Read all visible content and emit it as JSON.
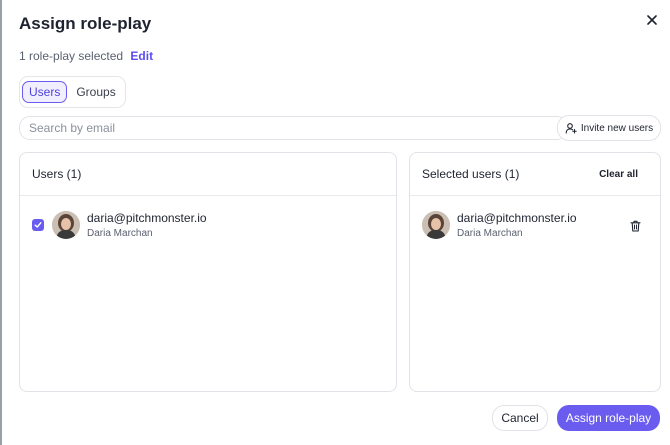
{
  "dialog": {
    "title": "Assign role-play",
    "selected_count_text": "1 role-play selected",
    "edit_label": "Edit"
  },
  "tabs": [
    {
      "label": "Users",
      "active": true
    },
    {
      "label": "Groups",
      "active": false
    }
  ],
  "search": {
    "placeholder": "Search by email",
    "value": ""
  },
  "invite_button": {
    "label": "Invite new users",
    "icon": "user-plus-icon"
  },
  "users_panel": {
    "header": "Users (1)",
    "users": [
      {
        "email": "daria@pitchmonster.io",
        "name": "Daria Marchan",
        "checked": true
      }
    ]
  },
  "selected_panel": {
    "header": "Selected users (1)",
    "clear_all_label": "Clear all",
    "users": [
      {
        "email": "daria@pitchmonster.io",
        "name": "Daria Marchan"
      }
    ]
  },
  "footer": {
    "cancel_label": "Cancel",
    "assign_label": "Assign role-play"
  },
  "colors": {
    "accent": "#6b5cf0",
    "text": "#1f2330",
    "muted": "#5b6170",
    "border": "#e1e3e8"
  }
}
